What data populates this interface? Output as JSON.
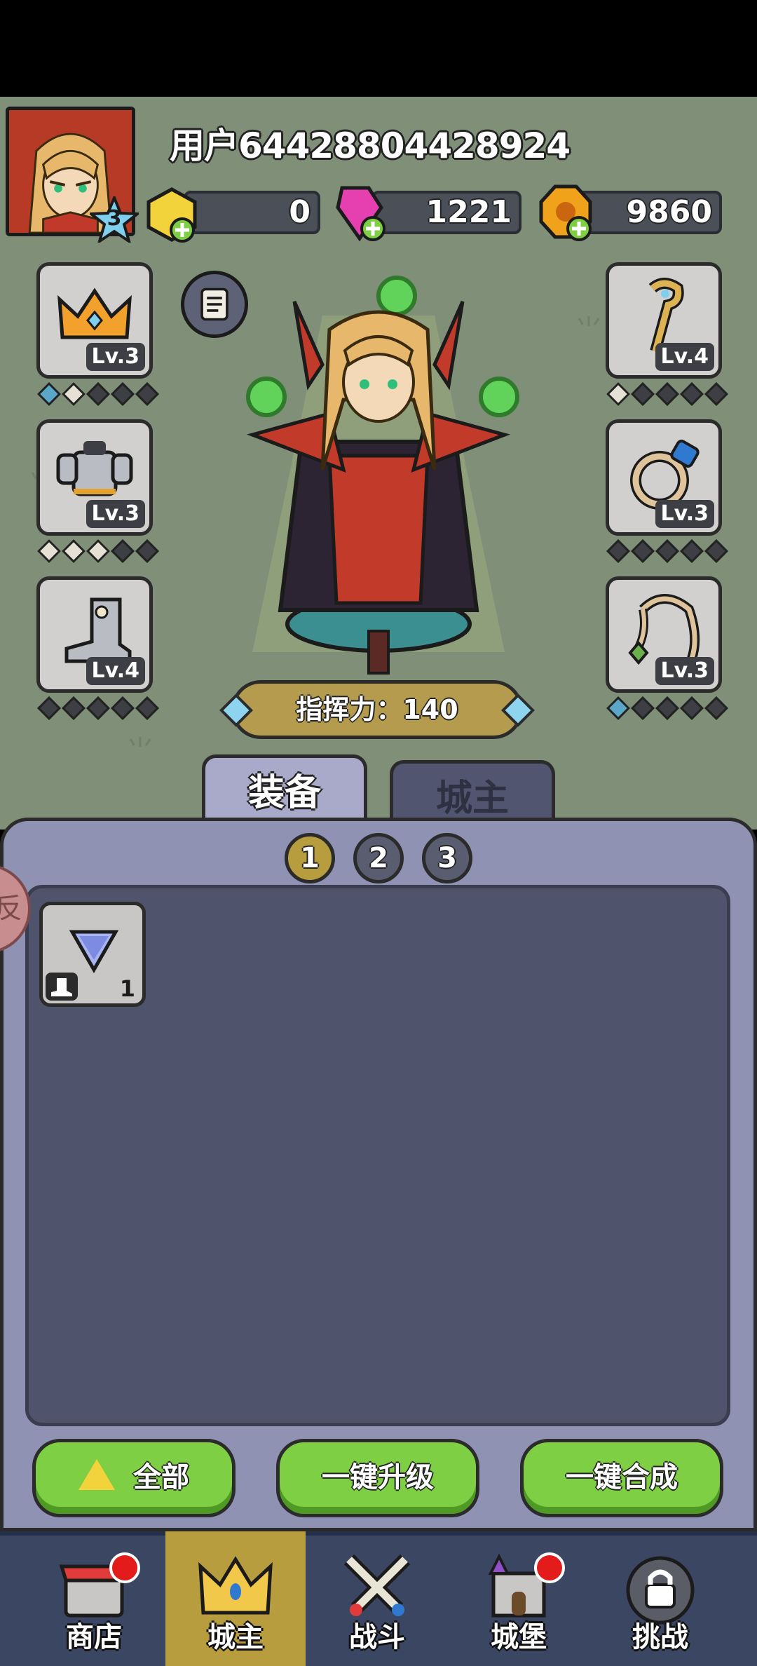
{
  "player": {
    "username": "用户64428804428924",
    "level": "3"
  },
  "currencies": {
    "gold_gem": "0",
    "pink_crystal": "1221",
    "coins": "9860"
  },
  "equipment": {
    "crown": "Lv.3",
    "armor": "Lv.3",
    "boots": "Lv.4",
    "staff": "Lv.4",
    "ring": "Lv.3",
    "necklace": "Lv.3"
  },
  "command_power": "指挥力：140",
  "tabs": {
    "equipment": "装备",
    "lord": "城主"
  },
  "pages": [
    "1",
    "2",
    "3"
  ],
  "side_badge": "反",
  "inventory": [
    {
      "count": "1",
      "icon": "blue-triangle-gem",
      "type_icon": "boot-icon"
    }
  ],
  "actions": {
    "all": "全部",
    "upgrade_all": "一键升级",
    "merge_all": "一键合成"
  },
  "nav": {
    "shop": "商店",
    "lord": "城主",
    "battle": "战斗",
    "castle": "城堡",
    "challenge": "挑战"
  },
  "colors": {
    "accent": "#b89d3f",
    "panel": "#9092b4",
    "button": "#7fcf44",
    "nav": "#3a4662"
  }
}
